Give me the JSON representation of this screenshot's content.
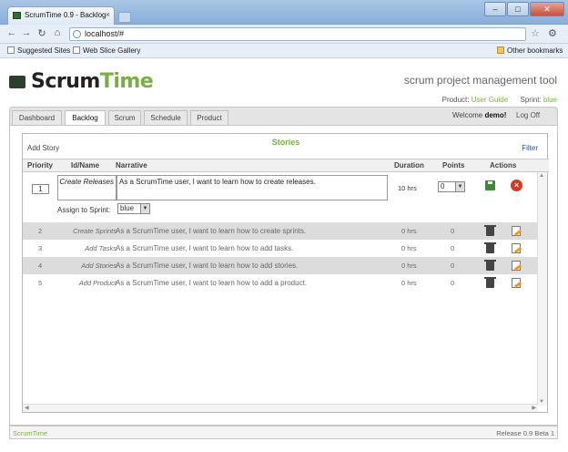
{
  "browser": {
    "tab_title": "ScrumTime 0.9 - Backlog",
    "url": "localhost/#",
    "bookmarks": [
      "Suggested Sites",
      "Web Slice Gallery"
    ],
    "other_bookmarks": "Other bookmarks"
  },
  "app": {
    "logo_scrum": "Scrum",
    "logo_time": "Time",
    "tagline": "scrum project management tool",
    "product_label": "Product:",
    "product_value": "User Guide",
    "sprint_label": "Sprint:",
    "sprint_value": "blue"
  },
  "nav": {
    "tabs": [
      "Dashboard",
      "Backlog",
      "Scrum",
      "Schedule",
      "Product"
    ],
    "active": "Backlog",
    "welcome_prefix": "Welcome",
    "user": "demo!",
    "logoff": "Log Off"
  },
  "stories": {
    "title": "Stories",
    "add_story": "Add Story",
    "filter": "Filter",
    "columns": [
      "Priority",
      "Id/Name",
      "Narrative",
      "Duration",
      "Points",
      "Actions"
    ],
    "edit_row": {
      "priority": "1",
      "name": "Create Releases",
      "narrative": "As a ScrumTime user, I want to learn how to create releases.",
      "duration": "10 hrs",
      "points": "0",
      "assign_label": "Assign to Sprint:",
      "assign_value": "blue"
    },
    "rows": [
      {
        "priority": "2",
        "name": "Create Sprints",
        "narrative": "As a ScrumTime user, I want to learn how to create sprints.",
        "duration": "0 hrs",
        "points": "0"
      },
      {
        "priority": "3",
        "name": "Add Tasks",
        "narrative": "As a ScrumTime user, I want to learn how to add tasks.",
        "duration": "0 hrs",
        "points": "0"
      },
      {
        "priority": "4",
        "name": "Add Stories",
        "narrative": "As a ScrumTime user, I want to learn how to add stories.",
        "duration": "0 hrs",
        "points": "0"
      },
      {
        "priority": "5",
        "name": "Add Product",
        "narrative": "As a ScrumTime user, I want to learn how to add a product.",
        "duration": "0 hrs",
        "points": "0"
      }
    ]
  },
  "footer": {
    "left": "ScrumTime",
    "right": "Release 0.9 Beta 1"
  }
}
